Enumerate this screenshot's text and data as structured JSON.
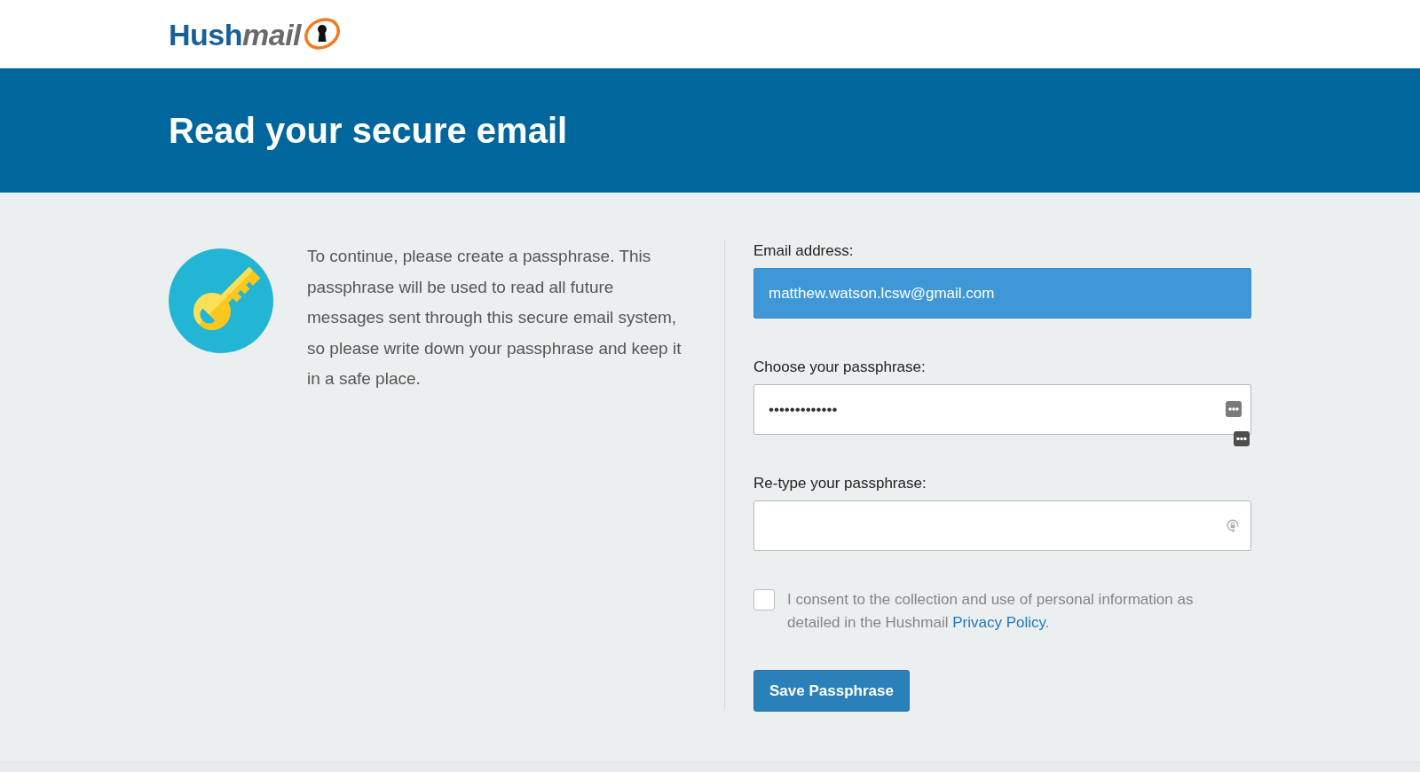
{
  "logo": {
    "parts": [
      {
        "text": "Hush",
        "kind": "strong"
      },
      {
        "text": "mail",
        "kind": "light"
      }
    ]
  },
  "banner": {
    "title": "Read your secure email"
  },
  "intro": {
    "text": "To continue, please create a passphrase. This passphrase will be used to read all future messages sent through this secure email system, so please write down your passphrase and keep it in a safe place."
  },
  "form": {
    "fields": [
      {
        "kind": "email",
        "label": "Email address:",
        "value": "matthew.watson.lcsw@gmail.com",
        "readonly": true
      },
      {
        "kind": "passphrase",
        "label": "Choose your passphrase:",
        "value": "•••••••••••••",
        "readonly": false
      },
      {
        "kind": "confirm",
        "label": "Re-type your passphrase:",
        "readonly": false
      }
    ],
    "consent": {
      "text": "I consent to the collection and use of personal information as detailed in the Hushmail",
      "link": "Privacy Policy",
      "end": ".",
      "checked": false
    },
    "submit": {
      "label": "Save Passphrase"
    }
  }
}
